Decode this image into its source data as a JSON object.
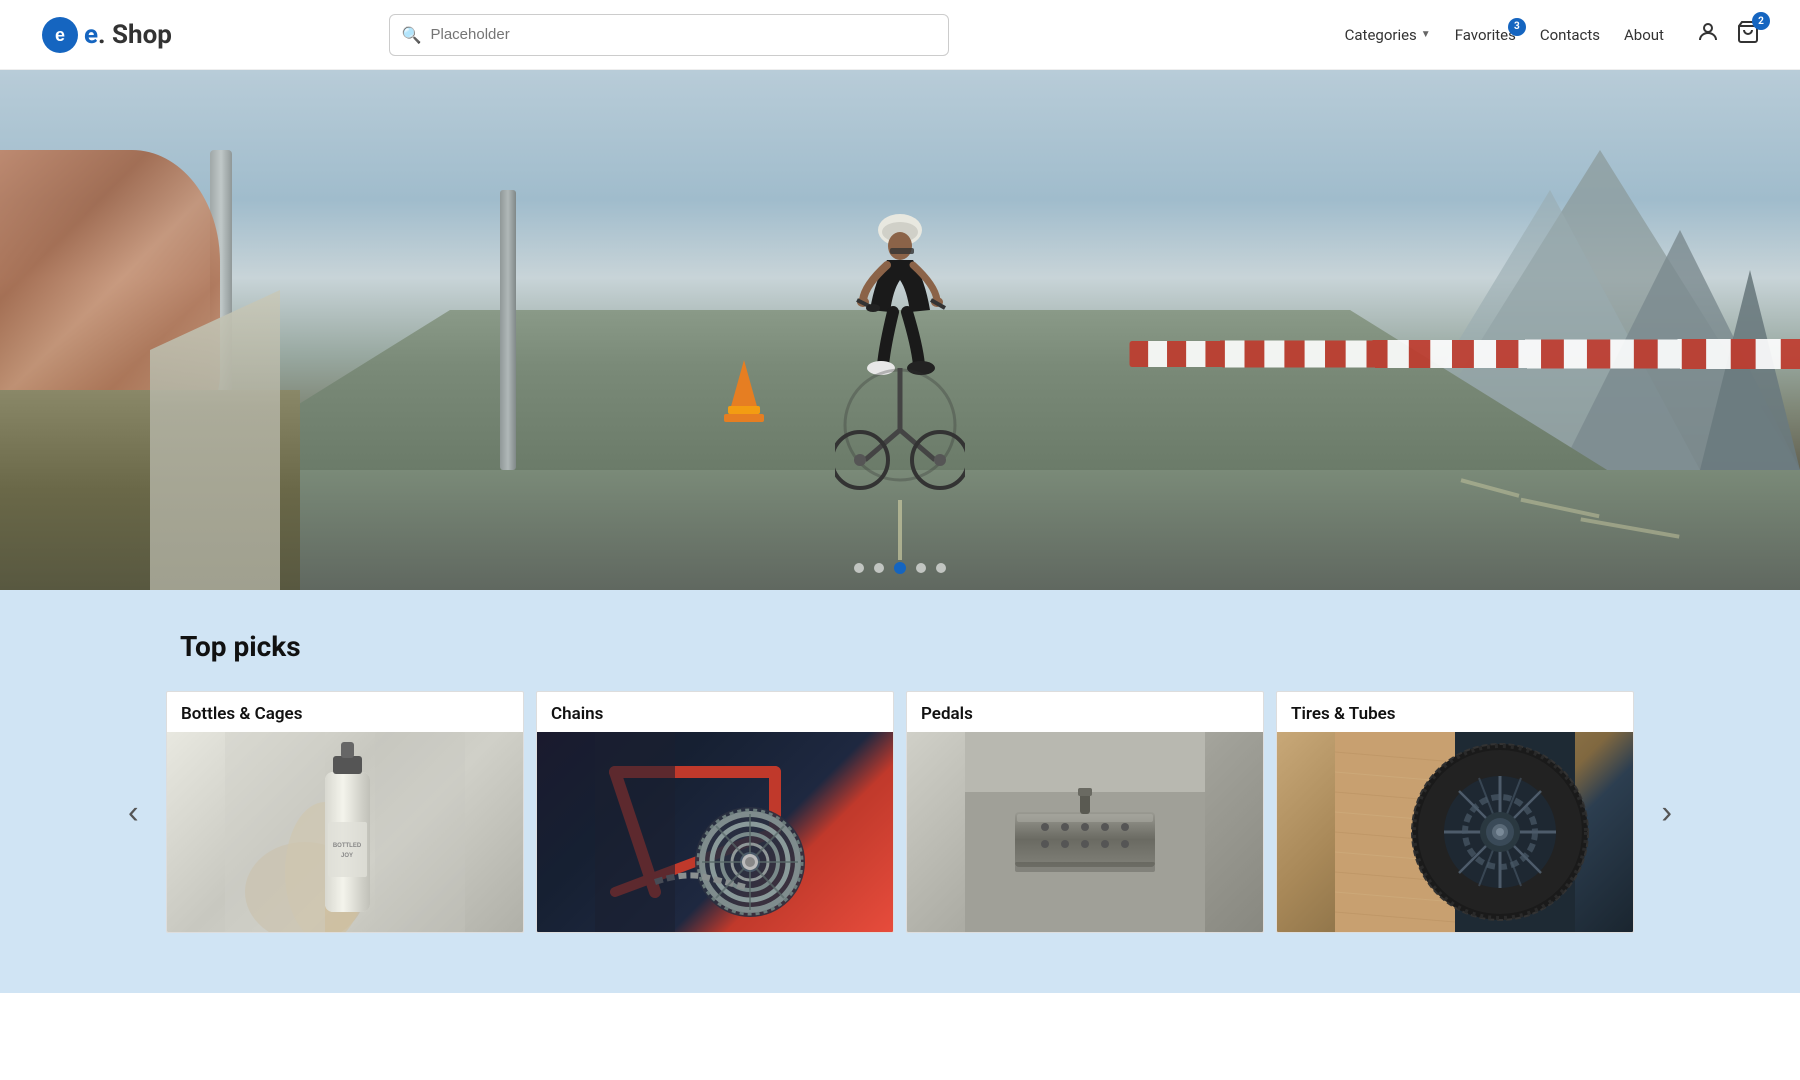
{
  "header": {
    "logo_text": "e. Shop",
    "logo_dot": "e",
    "logo_rest": ".Shop",
    "search_placeholder": "Placeholder",
    "nav": {
      "categories_label": "Categories",
      "favorites_label": "Favorites",
      "favorites_badge": "3",
      "contacts_label": "Contacts",
      "about_label": "About",
      "cart_badge": "2"
    }
  },
  "hero": {
    "dots": [
      "dot1",
      "dot2",
      "dot3-active",
      "dot4",
      "dot5"
    ],
    "active_dot": 2
  },
  "top_picks": {
    "title": "Top picks",
    "prev_label": "‹",
    "next_label": "›",
    "categories": [
      {
        "id": "bottles-cages",
        "label": "Bottles & Cages"
      },
      {
        "id": "chains",
        "label": "Chains"
      },
      {
        "id": "pedals",
        "label": "Pedals"
      },
      {
        "id": "tires-tubes",
        "label": "Tires & Tubes"
      }
    ]
  }
}
